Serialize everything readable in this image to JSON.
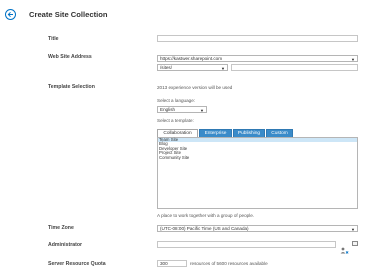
{
  "header": {
    "title": "Create Site Collection"
  },
  "title_field": {
    "label": "Title",
    "value": ""
  },
  "web_address": {
    "label": "Web Site Address",
    "domain": "https://kastwer.sharepoint.com",
    "path_prefix": "/sites/",
    "site_name": ""
  },
  "template": {
    "label": "Template Selection",
    "experience_note": "2013 experience version will be used",
    "language_label": "Select a language:",
    "language": "English",
    "template_label": "Select a template:",
    "tabs": [
      {
        "label": "Collaboration",
        "active": true
      },
      {
        "label": "Enterprise",
        "active": false
      },
      {
        "label": "Publishing",
        "active": false
      },
      {
        "label": "Custom",
        "active": false
      }
    ],
    "items": [
      {
        "label": "Team Site",
        "selected": true
      },
      {
        "label": "Blog",
        "selected": false
      },
      {
        "label": "Developer Site",
        "selected": false
      },
      {
        "label": "Project Site",
        "selected": false
      },
      {
        "label": "Community Site",
        "selected": false
      }
    ],
    "description": "A place to work together with a group of people."
  },
  "time_zone": {
    "label": "Time Zone",
    "value": "(UTC-08:00) Pacific Time (US and Canada)"
  },
  "administrator": {
    "label": "Administrator",
    "value": ""
  },
  "quota": {
    "label": "Server Resource Quota",
    "value": "300",
    "suffix": "resources of 5600 resources available"
  },
  "colors": {
    "accent": "#0072c6",
    "tab_inactive": "#3a8bc9",
    "selected_row": "#cde6f7"
  },
  "icons": {
    "back": "back-arrow-icon",
    "people_picker": "people-picker-icon",
    "browse": "address-book-icon"
  }
}
